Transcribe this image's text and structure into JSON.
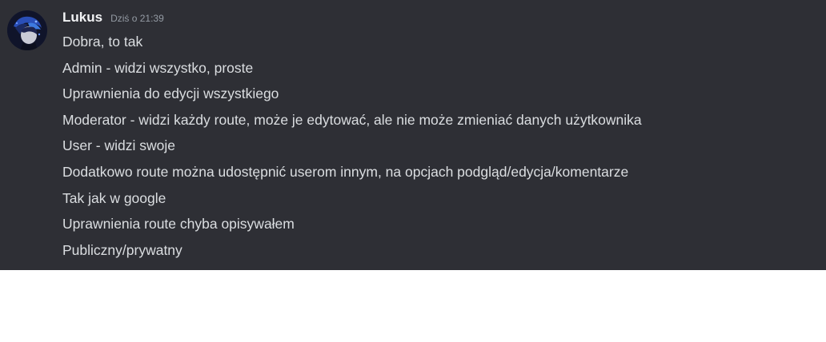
{
  "message": {
    "author": "Lukus",
    "timestamp": "Dziś o 21:39",
    "lines": [
      "Dobra, to tak",
      "Admin - widzi wszystko, proste",
      "Uprawnienia do edycji wszystkiego",
      "Moderator - widzi każdy route, może je edytować, ale nie może zmieniać danych użytkownika",
      "User - widzi swoje",
      "Dodatkowo route można udostępnić userom innym, na opcjach podgląd/edycja/komentarze",
      "Tak jak w google",
      "Uprawnienia route chyba opisywałem",
      "Publiczny/prywatny"
    ]
  },
  "colors": {
    "panel_background": "#2e2f35",
    "username": "#f2f3f5",
    "timestamp": "#949ba4",
    "message_text": "#dbdee1",
    "page_background": "#ffffff"
  }
}
